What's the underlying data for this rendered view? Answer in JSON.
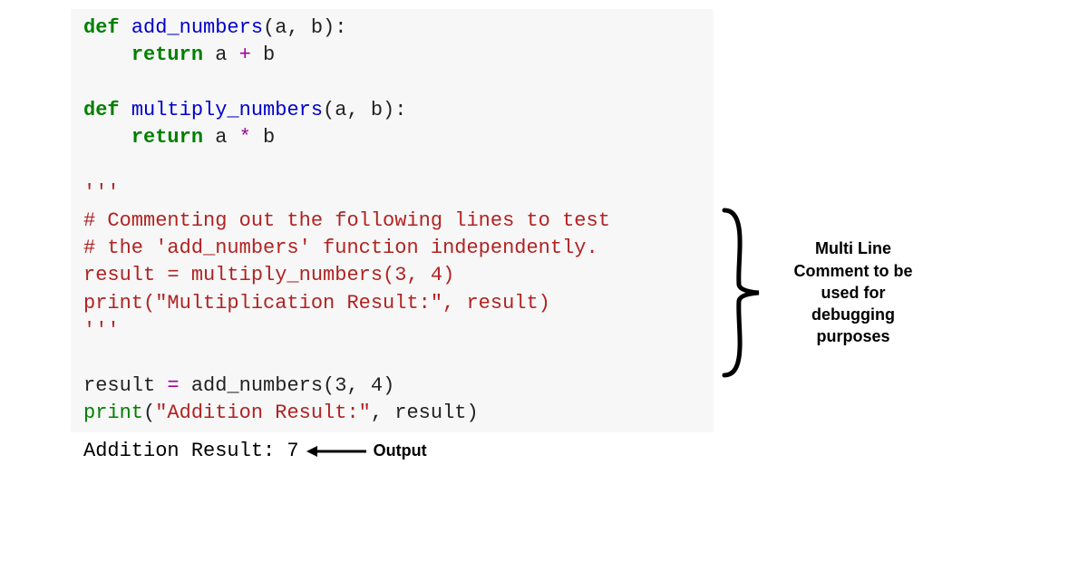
{
  "code": {
    "def": "def",
    "return": "return",
    "fn_add": "add_numbers",
    "fn_mul": "multiply_numbers",
    "params": "(a, b):",
    "ret_add": " a ",
    "plus": "+",
    "ret_b": " b",
    "ret_mul": " a ",
    "star": "*",
    "triple1": "'''",
    "comment1": "# Commenting out the following lines to test",
    "comment2": "# the 'add_numbers' function independently.",
    "assign_mul": "result = multiply_numbers(3, 4)",
    "print_mul": "print(\"Multiplication Result:\", result)",
    "triple2": "'''",
    "assign_add_pre": "result ",
    "eq": "=",
    "assign_add_post": " add_numbers(",
    "three": "3",
    "comma": ", ",
    "four": "4",
    "close_paren": ")",
    "print_kw": "print",
    "open_paren": "(",
    "str_add": "\"Addition Result:\"",
    "print_rest": ", result)"
  },
  "output": {
    "text": "Addition Result: 7",
    "label": "Output"
  },
  "annotation": {
    "line1": "Multi Line",
    "line2": "Comment to be",
    "line3": "used for",
    "line4": "debugging",
    "line5": "purposes"
  },
  "colors": {
    "keyword": "#008000",
    "function": "#0000cc",
    "operator": "#a000a0",
    "commented": "#b22222",
    "bg": "#f7f7f7"
  }
}
